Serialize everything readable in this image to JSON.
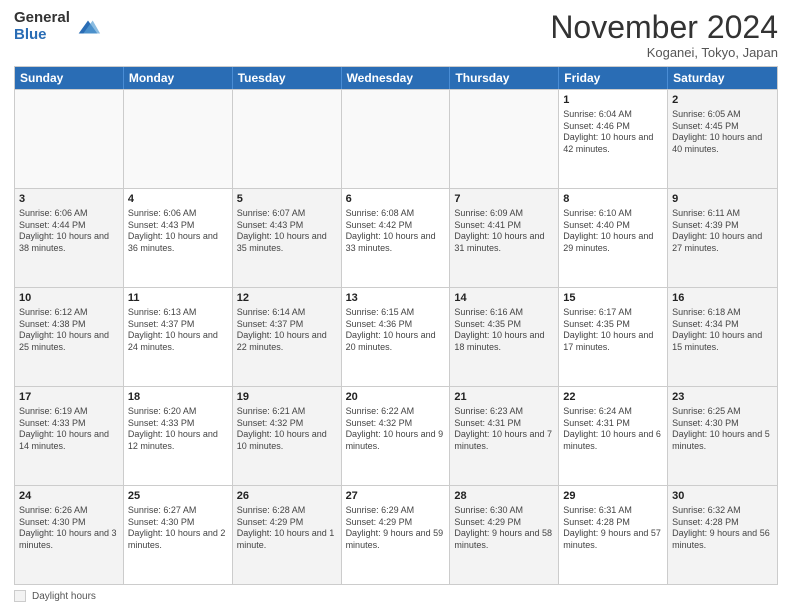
{
  "logo": {
    "general": "General",
    "blue": "Blue"
  },
  "header": {
    "month": "November 2024",
    "location": "Koganei, Tokyo, Japan"
  },
  "weekdays": [
    "Sunday",
    "Monday",
    "Tuesday",
    "Wednesday",
    "Thursday",
    "Friday",
    "Saturday"
  ],
  "legend": {
    "label": "Daylight hours"
  },
  "rows": [
    [
      {
        "day": "",
        "info": ""
      },
      {
        "day": "",
        "info": ""
      },
      {
        "day": "",
        "info": ""
      },
      {
        "day": "",
        "info": ""
      },
      {
        "day": "",
        "info": ""
      },
      {
        "day": "1",
        "info": "Sunrise: 6:04 AM\nSunset: 4:46 PM\nDaylight: 10 hours and 42 minutes."
      },
      {
        "day": "2",
        "info": "Sunrise: 6:05 AM\nSunset: 4:45 PM\nDaylight: 10 hours and 40 minutes."
      }
    ],
    [
      {
        "day": "3",
        "info": "Sunrise: 6:06 AM\nSunset: 4:44 PM\nDaylight: 10 hours and 38 minutes."
      },
      {
        "day": "4",
        "info": "Sunrise: 6:06 AM\nSunset: 4:43 PM\nDaylight: 10 hours and 36 minutes."
      },
      {
        "day": "5",
        "info": "Sunrise: 6:07 AM\nSunset: 4:43 PM\nDaylight: 10 hours and 35 minutes."
      },
      {
        "day": "6",
        "info": "Sunrise: 6:08 AM\nSunset: 4:42 PM\nDaylight: 10 hours and 33 minutes."
      },
      {
        "day": "7",
        "info": "Sunrise: 6:09 AM\nSunset: 4:41 PM\nDaylight: 10 hours and 31 minutes."
      },
      {
        "day": "8",
        "info": "Sunrise: 6:10 AM\nSunset: 4:40 PM\nDaylight: 10 hours and 29 minutes."
      },
      {
        "day": "9",
        "info": "Sunrise: 6:11 AM\nSunset: 4:39 PM\nDaylight: 10 hours and 27 minutes."
      }
    ],
    [
      {
        "day": "10",
        "info": "Sunrise: 6:12 AM\nSunset: 4:38 PM\nDaylight: 10 hours and 25 minutes."
      },
      {
        "day": "11",
        "info": "Sunrise: 6:13 AM\nSunset: 4:37 PM\nDaylight: 10 hours and 24 minutes."
      },
      {
        "day": "12",
        "info": "Sunrise: 6:14 AM\nSunset: 4:37 PM\nDaylight: 10 hours and 22 minutes."
      },
      {
        "day": "13",
        "info": "Sunrise: 6:15 AM\nSunset: 4:36 PM\nDaylight: 10 hours and 20 minutes."
      },
      {
        "day": "14",
        "info": "Sunrise: 6:16 AM\nSunset: 4:35 PM\nDaylight: 10 hours and 18 minutes."
      },
      {
        "day": "15",
        "info": "Sunrise: 6:17 AM\nSunset: 4:35 PM\nDaylight: 10 hours and 17 minutes."
      },
      {
        "day": "16",
        "info": "Sunrise: 6:18 AM\nSunset: 4:34 PM\nDaylight: 10 hours and 15 minutes."
      }
    ],
    [
      {
        "day": "17",
        "info": "Sunrise: 6:19 AM\nSunset: 4:33 PM\nDaylight: 10 hours and 14 minutes."
      },
      {
        "day": "18",
        "info": "Sunrise: 6:20 AM\nSunset: 4:33 PM\nDaylight: 10 hours and 12 minutes."
      },
      {
        "day": "19",
        "info": "Sunrise: 6:21 AM\nSunset: 4:32 PM\nDaylight: 10 hours and 10 minutes."
      },
      {
        "day": "20",
        "info": "Sunrise: 6:22 AM\nSunset: 4:32 PM\nDaylight: 10 hours and 9 minutes."
      },
      {
        "day": "21",
        "info": "Sunrise: 6:23 AM\nSunset: 4:31 PM\nDaylight: 10 hours and 7 minutes."
      },
      {
        "day": "22",
        "info": "Sunrise: 6:24 AM\nSunset: 4:31 PM\nDaylight: 10 hours and 6 minutes."
      },
      {
        "day": "23",
        "info": "Sunrise: 6:25 AM\nSunset: 4:30 PM\nDaylight: 10 hours and 5 minutes."
      }
    ],
    [
      {
        "day": "24",
        "info": "Sunrise: 6:26 AM\nSunset: 4:30 PM\nDaylight: 10 hours and 3 minutes."
      },
      {
        "day": "25",
        "info": "Sunrise: 6:27 AM\nSunset: 4:30 PM\nDaylight: 10 hours and 2 minutes."
      },
      {
        "day": "26",
        "info": "Sunrise: 6:28 AM\nSunset: 4:29 PM\nDaylight: 10 hours and 1 minute."
      },
      {
        "day": "27",
        "info": "Sunrise: 6:29 AM\nSunset: 4:29 PM\nDaylight: 9 hours and 59 minutes."
      },
      {
        "day": "28",
        "info": "Sunrise: 6:30 AM\nSunset: 4:29 PM\nDaylight: 9 hours and 58 minutes."
      },
      {
        "day": "29",
        "info": "Sunrise: 6:31 AM\nSunset: 4:28 PM\nDaylight: 9 hours and 57 minutes."
      },
      {
        "day": "30",
        "info": "Sunrise: 6:32 AM\nSunset: 4:28 PM\nDaylight: 9 hours and 56 minutes."
      }
    ]
  ]
}
